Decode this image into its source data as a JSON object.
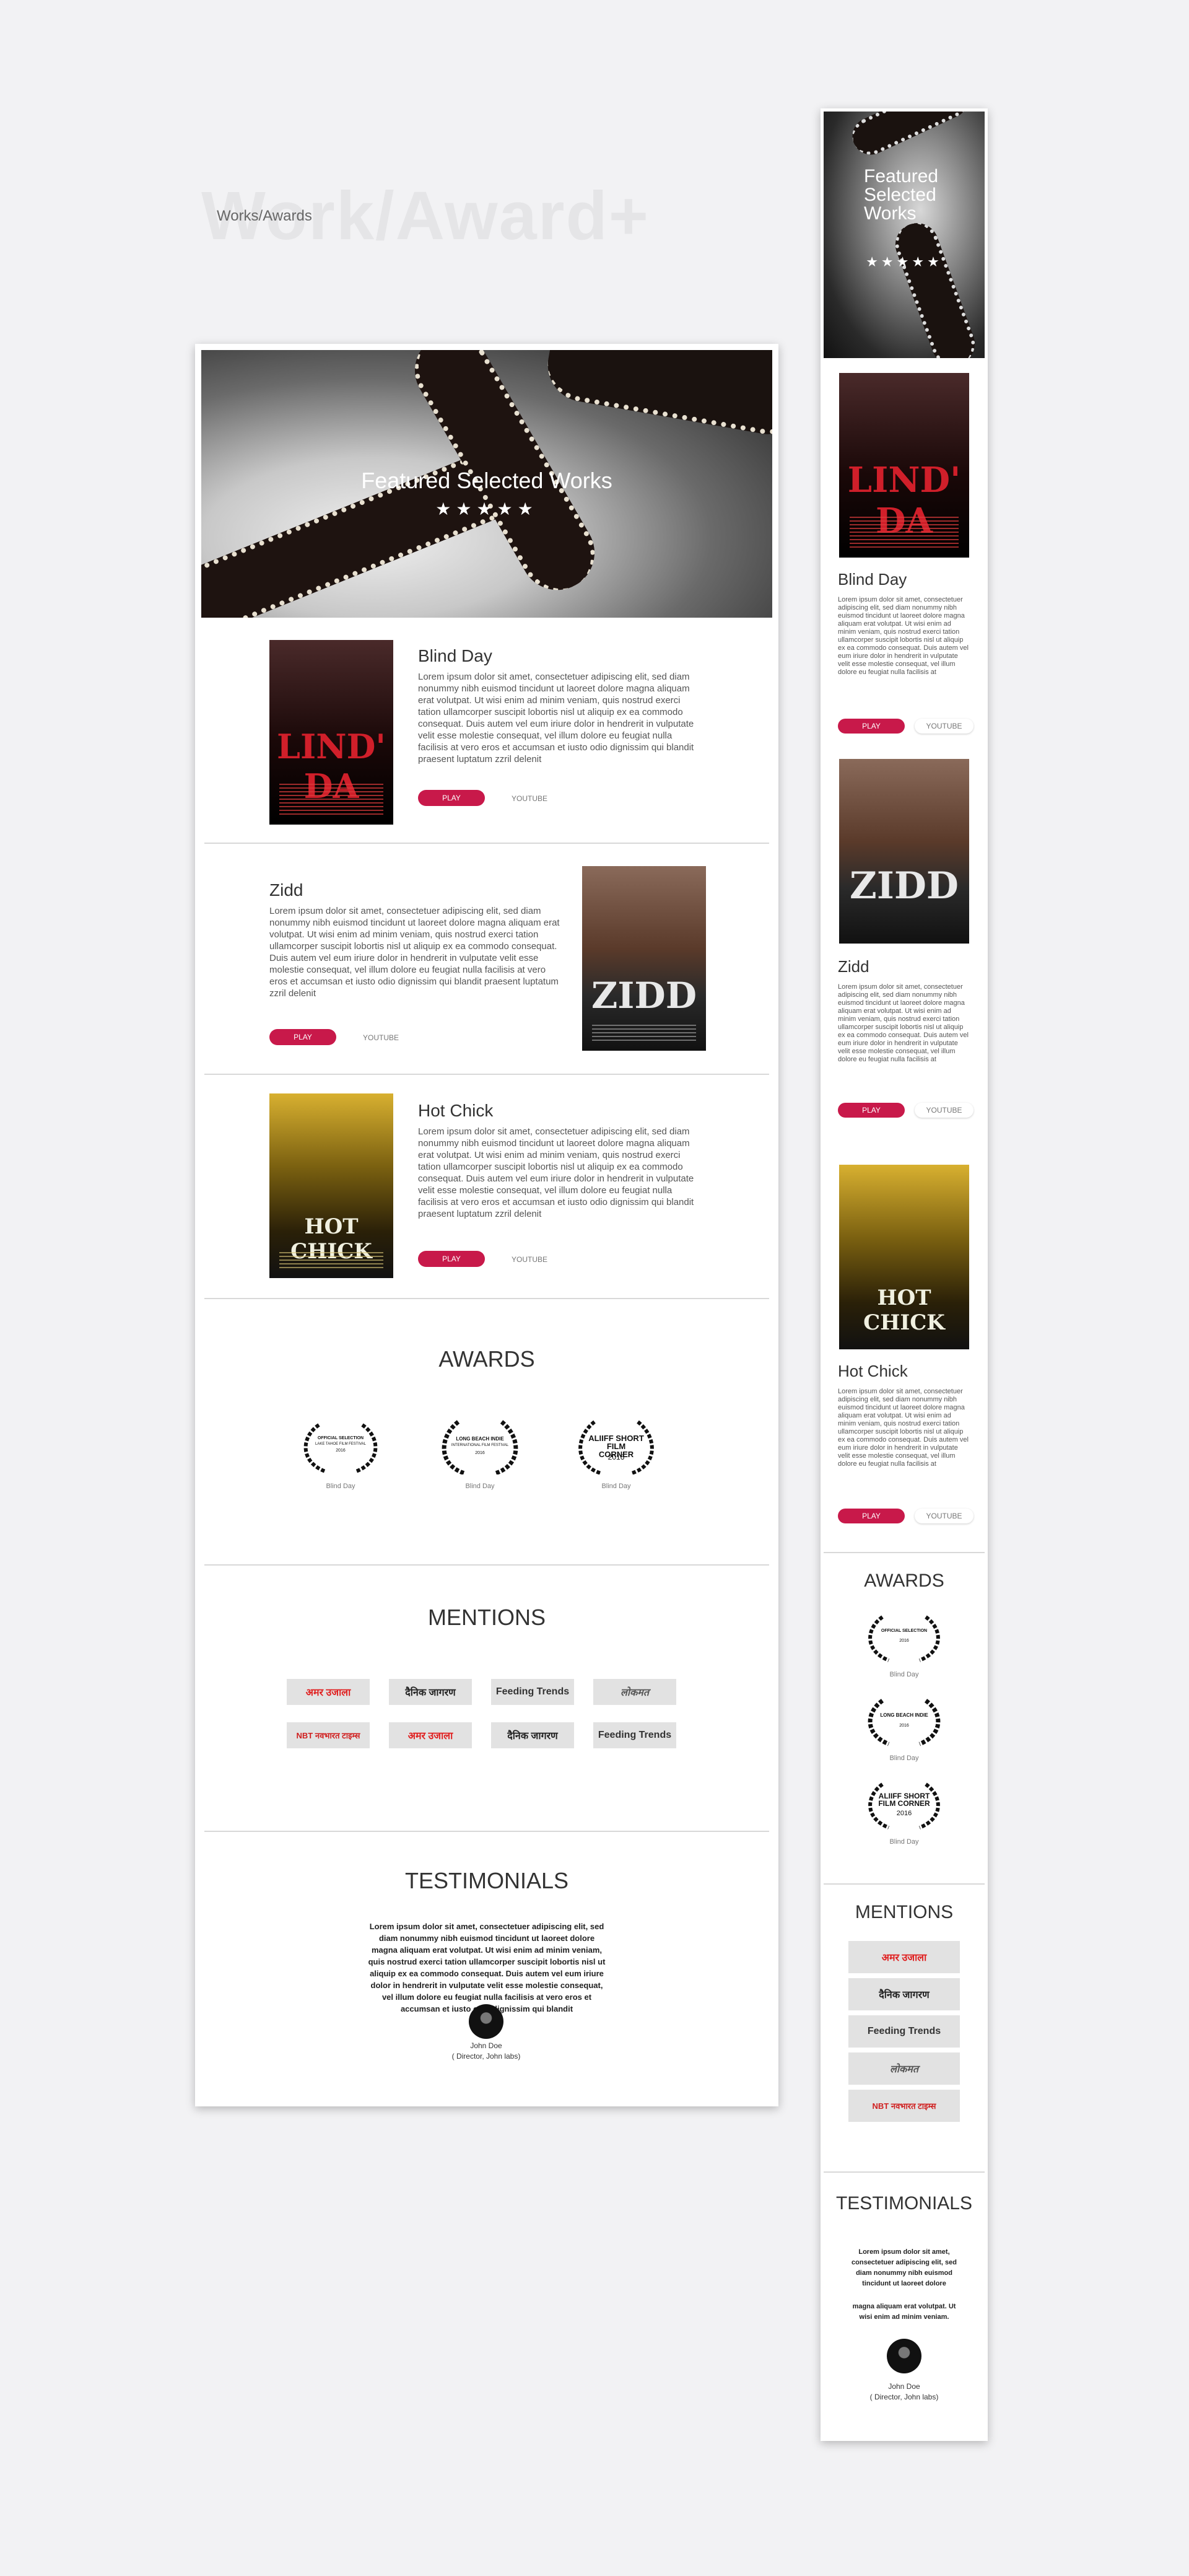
{
  "background_title": "Work/Award+",
  "page_label": "Works/Awards",
  "colors": {
    "accent": "#c8194a",
    "page_bg": "#f2f2f4"
  },
  "hero": {
    "title": "Featured Selected Works",
    "stars": "★★★★★"
  },
  "works": [
    {
      "title": "Blind Day",
      "poster_title": "LIND' DA",
      "poster_bg": "#3a1a18",
      "poster_color": "#d01f2a",
      "desc": "Lorem ipsum dolor sit amet, consectetuer adipiscing elit, sed diam nonummy nibh euismod tincidunt ut laoreet dolore magna aliquam erat volutpat. Ut wisi enim ad minim veniam, quis nostrud exerci tation ullamcorper suscipit lobortis nisl ut aliquip ex ea commodo consequat. Duis autem vel eum iriure dolor in hendrerit in vulputate velit esse molestie consequat, vel illum dolore eu feugiat nulla facilisis at vero eros et accumsan et iusto odio dignissim qui blandit praesent luptatum zzril delenit",
      "play": "PLAY",
      "youtube": "YOUTUBE"
    },
    {
      "title": "Zidd",
      "poster_title": "ZIDD",
      "poster_bg": "#6a4a3a",
      "poster_color": "#e8e8e8",
      "desc": "Lorem ipsum dolor sit amet, consectetuer adipiscing elit, sed diam nonummy nibh euismod tincidunt ut laoreet dolore magna aliquam erat volutpat. Ut wisi enim ad minim veniam, quis nostrud exerci tation ullamcorper suscipit lobortis nisl ut aliquip ex ea commodo consequat. Duis autem vel eum iriure dolor in hendrerit in vulputate velit esse molestie consequat, vel illum dolore eu feugiat nulla facilisis at vero eros et accumsan et iusto odio dignissim qui blandit praesent luptatum zzril delenit",
      "play": "PLAY",
      "youtube": "YOUTUBE"
    },
    {
      "title": "Hot Chick",
      "poster_title": "HOT CHICK",
      "poster_bg": "#5a4a10",
      "poster_color": "#f0f0e0",
      "desc": "Lorem ipsum dolor sit amet, consectetuer adipiscing elit, sed diam nonummy nibh euismod tincidunt ut laoreet dolore magna aliquam erat volutpat. Ut wisi enim ad minim veniam, quis nostrud exerci tation ullamcorper suscipit lobortis nisl ut aliquip ex ea commodo consequat. Duis autem vel eum iriure dolor in hendrerit in vulputate velit esse molestie consequat, vel illum dolore eu feugiat nulla facilisis at vero eros et accumsan et iusto odio dignissim qui blandit praesent luptatum zzril delenit",
      "play": "PLAY",
      "youtube": "YOUTUBE"
    }
  ],
  "mobile_works_desc": [
    "Lorem ipsum dolor sit amet, consectetuer adipiscing elit, sed diam nonummy nibh euismod tincidunt ut laoreet dolore magna aliquam erat volutpat. Ut wisi enim ad minim veniam, quis nostrud exerci tation ullamcorper suscipit lobortis nisl ut aliquip ex ea commodo consequat. Duis autem vel eum iriure dolor in hendrerit in vulputate velit esse molestie consequat, vel illum dolore eu feugiat nulla facilisis at",
    "Lorem ipsum dolor sit amet, consectetuer adipiscing elit, sed diam nonummy nibh euismod tincidunt ut laoreet dolore magna aliquam erat volutpat. Ut wisi enim ad minim veniam, quis nostrud exerci tation ullamcorper suscipit lobortis nisl ut aliquip ex ea commodo consequat. Duis autem vel eum iriure dolor in hendrerit in vulputate velit esse molestie consequat, vel illum dolore eu feugiat nulla facilisis at",
    "Lorem ipsum dolor sit amet, consectetuer adipiscing elit, sed diam nonummy nibh euismod tincidunt ut laoreet dolore magna aliquam erat volutpat. Ut wisi enim ad minim veniam, quis nostrud exerci tation ullamcorper suscipit lobortis nisl ut aliquip ex ea commodo consequat. Duis autem vel eum iriure dolor in hendrerit in vulputate velit esse molestie consequat, vel illum dolore eu feugiat nulla facilisis at"
  ],
  "awards": {
    "heading": "AWARDS",
    "items": [
      {
        "badge": "OFFICIAL SELECTION",
        "sub": "LAKE TAHOE FILM FESTIVAL",
        "year": "2016",
        "caption": "Blind Day"
      },
      {
        "badge": "LONG BEACH INDIE",
        "sub": "INTERNATIONAL FILM FESTIVAL",
        "year": "2016",
        "caption": "Blind Day"
      },
      {
        "badge": "ALIIFF SHORT FILM CORNER",
        "sub": "",
        "year": "2016",
        "caption": "Blind Day"
      }
    ]
  },
  "mentions": {
    "heading": "MENTIONS",
    "logos": [
      {
        "text": "अमर उजाला",
        "color": "#e02020"
      },
      {
        "text": "दैनिक जागरण",
        "color": "#222222"
      },
      {
        "text": "Feeding Trends",
        "color": "#333333"
      },
      {
        "text": "लोकमत",
        "color": "#555555"
      },
      {
        "text": "NBT नवभारत टाइम्स",
        "color": "#d02020"
      },
      {
        "text": "अमर उजाला",
        "color": "#e02020"
      },
      {
        "text": "दैनिक जागरण",
        "color": "#222222"
      },
      {
        "text": "Feeding Trends",
        "color": "#333333"
      }
    ]
  },
  "testimonials": {
    "heading": "TESTIMONIALS",
    "text": "Lorem ipsum dolor sit amet, consectetuer adipiscing elit, sed diam nonummy nibh euismod tincidunt ut laoreet dolore magna aliquam erat volutpat. Ut wisi enim ad minim veniam, quis nostrud exerci tation ullamcorper suscipit lobortis nisl ut aliquip ex ea commodo consequat. Duis autem vel eum iriure dolor in hendrerit in vulputate velit esse molestie consequat, vel illum dolore eu feugiat nulla facilisis at vero eros et accumsan et iusto odio dignissim qui blandit",
    "mobile_text_1": "Lorem ipsum dolor sit amet, consectetuer adipiscing elit, sed diam nonummy nibh euismod tincidunt ut laoreet dolore",
    "mobile_text_2": "magna aliquam erat volutpat. Ut wisi enim ad minim veniam.",
    "name": "John Doe",
    "role": "( Director, John labs)"
  },
  "mobile_hero": {
    "title": "Featured Selected Works",
    "stars": "★★★★★"
  }
}
